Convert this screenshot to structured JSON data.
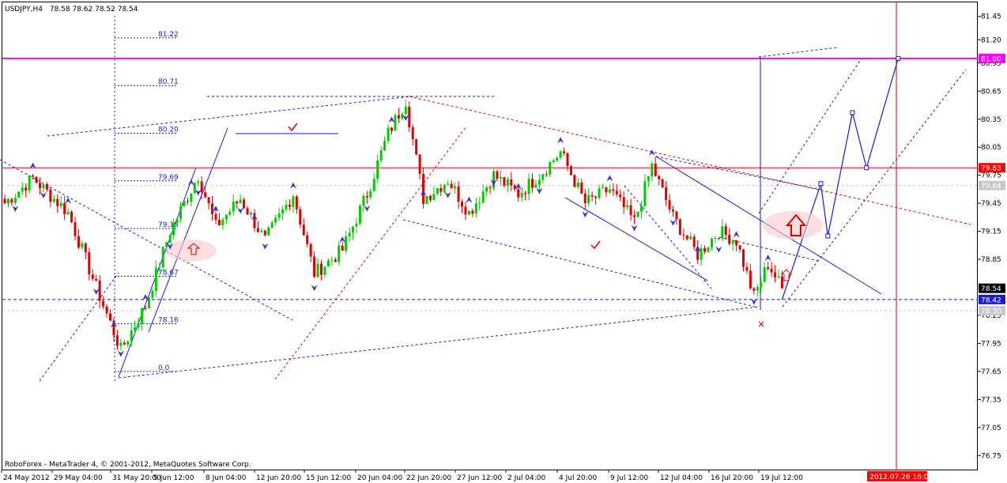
{
  "header": {
    "symbol_label": "USDJPY,H4",
    "ohlc": "78.58 78.62 78.52 78.54"
  },
  "footer": {
    "copyright": "RoboForex - MetaTrader 4, © 2001-2012, MetaQuotes Software Corp."
  },
  "colors": {
    "background": "#ffffff",
    "bull": "#00cc00",
    "bear": "#e00000",
    "wave_lines": "#1a1acc",
    "resistance": "#ff0000",
    "level_81": "#ff00ff",
    "arrow": "#3333cc"
  },
  "price_tags": [
    {
      "value": "81.00",
      "price": 81.0,
      "bg": "#ff00ff",
      "fg": "#ffffff"
    },
    {
      "value": "79.83",
      "price": 79.83,
      "bg": "#ff0000",
      "fg": "#ffffff"
    },
    {
      "value": "79.64",
      "price": 79.64,
      "bg": "#c8c8c8",
      "fg": "#ffffff"
    },
    {
      "value": "78.54",
      "price": 78.54,
      "bg": "#000000",
      "fg": "#ffffff"
    },
    {
      "value": "78.42",
      "price": 78.42,
      "bg": "#1a1acc",
      "fg": "#ffffff"
    },
    {
      "value": "78.30",
      "price": 78.3,
      "bg": "#c8c8c8",
      "fg": "#ffffff"
    }
  ],
  "date_tag": {
    "value": "2012.07.26 16:00",
    "bg": "#ff0000",
    "fg": "#ffffff"
  },
  "fib_levels": [
    {
      "label": "81.22",
      "price": 81.22
    },
    {
      "label": "80.71",
      "price": 80.71
    },
    {
      "label": "80.20",
      "price": 80.2
    },
    {
      "label": "79.69",
      "price": 79.69
    },
    {
      "label": "79.18",
      "price": 79.18
    },
    {
      "label": "78.67",
      "price": 78.67
    },
    {
      "label": "78.16",
      "price": 78.16
    },
    {
      "label": "0.0",
      "price": 77.65
    }
  ],
  "chart_data": {
    "type": "candlestick",
    "symbol": "USDJPY",
    "timeframe": "H4",
    "ylim": [
      76.6,
      81.6
    ],
    "y_ticks": [
      {
        "label": "81.45",
        "value": 81.45
      },
      {
        "label": "81.20",
        "value": 81.2
      },
      {
        "label": "80.95",
        "value": 80.95
      },
      {
        "label": "80.65",
        "value": 80.65
      },
      {
        "label": "80.35",
        "value": 80.35
      },
      {
        "label": "80.05",
        "value": 80.05
      },
      {
        "label": "79.75",
        "value": 79.75
      },
      {
        "label": "79.45",
        "value": 79.45
      },
      {
        "label": "79.15",
        "value": 79.15
      },
      {
        "label": "78.85",
        "value": 78.85
      },
      {
        "label": "78.25",
        "value": 78.25
      },
      {
        "label": "77.95",
        "value": 77.95
      },
      {
        "label": "77.65",
        "value": 77.65
      },
      {
        "label": "77.35",
        "value": 77.35
      },
      {
        "label": "77.05",
        "value": 77.05
      },
      {
        "label": "76.75",
        "value": 76.75
      }
    ],
    "x_ticks": [
      "24 May 2012",
      "29 May 04:00",
      "31 May 20:00",
      "5 Jun 12:00",
      "8 Jun 04:00",
      "12 Jun 20:00",
      "15 Jun 12:00",
      "20 Jun 04:00",
      "22 Jun 20:00",
      "27 Jun 12:00",
      "2 Jul 04:00",
      "4 Jul 20:00",
      "9 Jul 12:00",
      "12 Jul 04:00",
      "16 Jul 20:00",
      "19 Jul 12:00"
    ],
    "horizontal_levels": [
      81.0,
      79.83,
      79.64,
      78.42,
      78.3
    ],
    "anchors": [
      {
        "bar": 0,
        "price": 79.45
      },
      {
        "bar": 8,
        "price": 79.72
      },
      {
        "bar": 18,
        "price": 79.35
      },
      {
        "bar": 26,
        "price": 78.55
      },
      {
        "bar": 33,
        "price": 77.88
      },
      {
        "bar": 40,
        "price": 78.35
      },
      {
        "bar": 47,
        "price": 79.15
      },
      {
        "bar": 55,
        "price": 79.75
      },
      {
        "bar": 60,
        "price": 79.2
      },
      {
        "bar": 67,
        "price": 79.5
      },
      {
        "bar": 74,
        "price": 79.05
      },
      {
        "bar": 82,
        "price": 79.55
      },
      {
        "bar": 88,
        "price": 78.7
      },
      {
        "bar": 96,
        "price": 78.95
      },
      {
        "bar": 103,
        "price": 79.55
      },
      {
        "bar": 109,
        "price": 80.2
      },
      {
        "bar": 114,
        "price": 80.55
      },
      {
        "bar": 119,
        "price": 79.5
      },
      {
        "bar": 126,
        "price": 79.7
      },
      {
        "bar": 132,
        "price": 79.35
      },
      {
        "bar": 139,
        "price": 79.75
      },
      {
        "bar": 146,
        "price": 79.55
      },
      {
        "bar": 152,
        "price": 79.75
      },
      {
        "bar": 158,
        "price": 80.0
      },
      {
        "bar": 165,
        "price": 79.45
      },
      {
        "bar": 172,
        "price": 79.6
      },
      {
        "bar": 179,
        "price": 79.25
      },
      {
        "bar": 184,
        "price": 79.85
      },
      {
        "bar": 190,
        "price": 79.3
      },
      {
        "bar": 197,
        "price": 78.9
      },
      {
        "bar": 203,
        "price": 79.15
      },
      {
        "bar": 208,
        "price": 79.05
      },
      {
        "bar": 213,
        "price": 78.45
      },
      {
        "bar": 217,
        "price": 78.8
      },
      {
        "bar": 221,
        "price": 78.54
      }
    ],
    "forecast_path": [
      {
        "bar": 221,
        "price": 78.42
      },
      {
        "bar": 232,
        "price": 79.66
      },
      {
        "bar": 234,
        "price": 79.1
      },
      {
        "bar": 241,
        "price": 80.42
      },
      {
        "bar": 245,
        "price": 79.83
      },
      {
        "bar": 254,
        "price": 81.0
      }
    ]
  }
}
